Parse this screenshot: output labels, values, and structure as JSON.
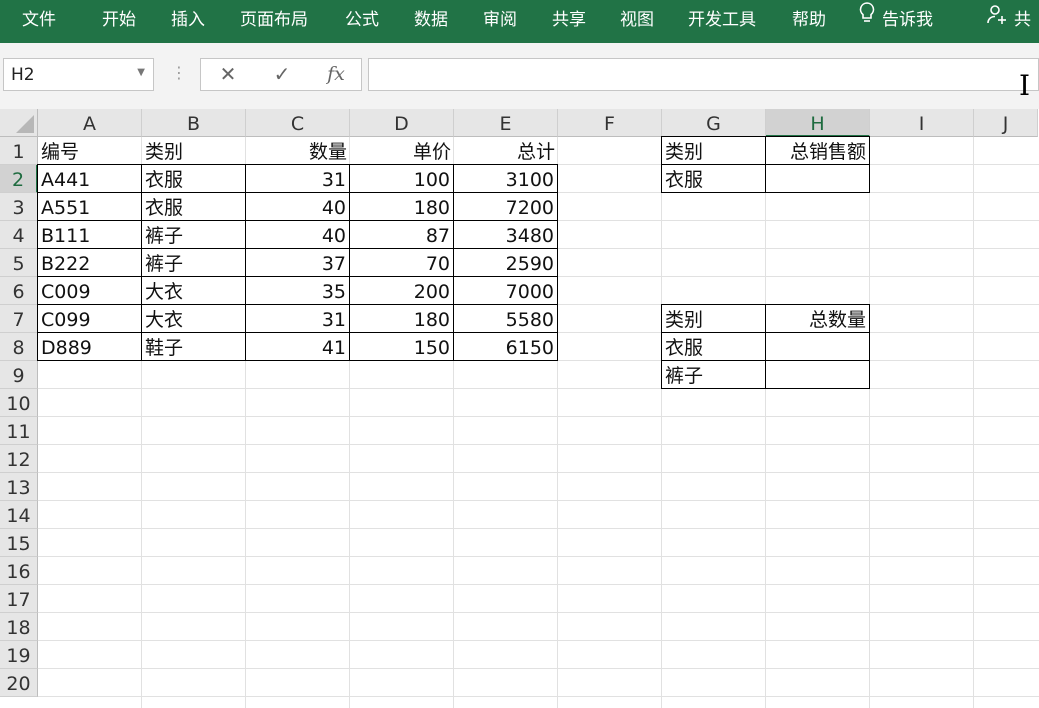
{
  "ribbon": {
    "tabs": [
      "文件",
      "开始",
      "插入",
      "页面布局",
      "公式",
      "数据",
      "审阅",
      "共享",
      "视图",
      "开发工具",
      "帮助"
    ],
    "tell_me": "告诉我",
    "share": "共",
    "color": "#217346"
  },
  "formula_bar": {
    "name_box": "H2",
    "cancel": "✕",
    "enter": "✓",
    "fx": "fx",
    "value": ""
  },
  "grid": {
    "columns": [
      "A",
      "B",
      "C",
      "D",
      "E",
      "F",
      "G",
      "H",
      "I",
      "J"
    ],
    "rows": [
      "1",
      "2",
      "3",
      "4",
      "5",
      "6",
      "7",
      "8",
      "9",
      "10",
      "11",
      "12",
      "13",
      "14",
      "15",
      "16",
      "17",
      "18",
      "19",
      "20"
    ],
    "selected_cell": "H2",
    "headers": {
      "id": "编号",
      "category": "类别",
      "qty": "数量",
      "price": "单价",
      "total": "总计"
    },
    "data_rows": [
      {
        "id": "A441",
        "category": "衣服",
        "qty": "31",
        "price": "100",
        "total": "3100"
      },
      {
        "id": "A551",
        "category": "衣服",
        "qty": "40",
        "price": "180",
        "total": "7200"
      },
      {
        "id": "B111",
        "category": "裤子",
        "qty": "40",
        "price": "87",
        "total": "3480"
      },
      {
        "id": "B222",
        "category": "裤子",
        "qty": "37",
        "price": "70",
        "total": "2590"
      },
      {
        "id": "C009",
        "category": "大衣",
        "qty": "35",
        "price": "200",
        "total": "7000"
      },
      {
        "id": "C099",
        "category": "大衣",
        "qty": "31",
        "price": "180",
        "total": "5580"
      },
      {
        "id": "D889",
        "category": "鞋子",
        "qty": "41",
        "price": "150",
        "total": "6150"
      }
    ],
    "summary1": {
      "col_category": "类别",
      "col_value": "总销售额",
      "rows": [
        {
          "category": "衣服",
          "value": ""
        }
      ]
    },
    "summary2": {
      "col_category": "类别",
      "col_value": "总数量",
      "rows": [
        {
          "category": "衣服",
          "value": ""
        },
        {
          "category": "裤子",
          "value": ""
        }
      ]
    }
  }
}
